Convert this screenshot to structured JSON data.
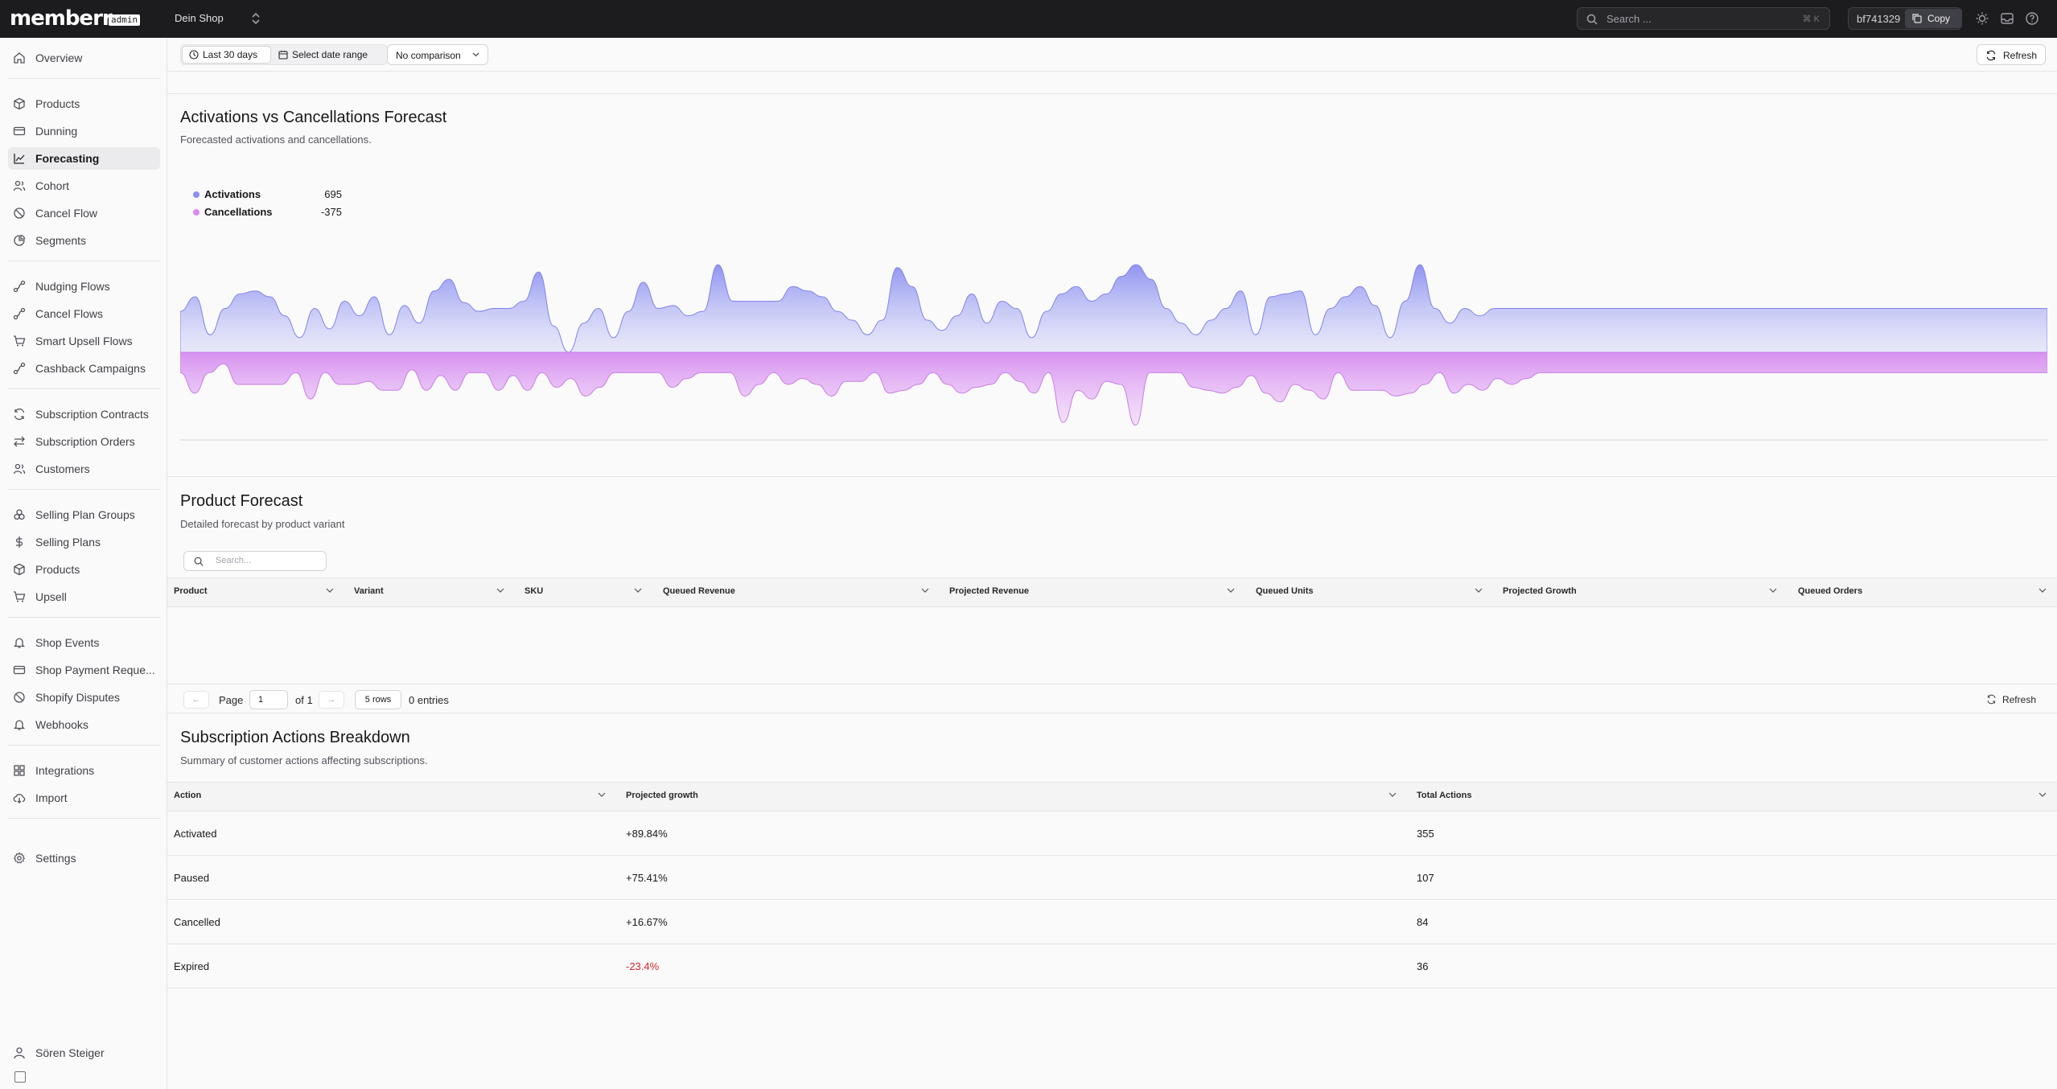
{
  "topbar": {
    "logo": "memberr",
    "logo_badge": "admin",
    "shop_name": "Dein Shop",
    "search_placeholder": "Search ...",
    "search_shortcut": "⌘ K",
    "shop_id": "bf741329",
    "copy_label": "Copy"
  },
  "sidebar": {
    "items": [
      {
        "label": "Overview",
        "icon": "home-icon"
      },
      {
        "label": "Products",
        "icon": "box-icon"
      },
      {
        "label": "Dunning",
        "icon": "card-icon"
      },
      {
        "label": "Forecasting",
        "icon": "line-chart-icon"
      },
      {
        "label": "Cohort",
        "icon": "users-icon"
      },
      {
        "label": "Cancel Flow",
        "icon": "ban-icon"
      },
      {
        "label": "Segments",
        "icon": "pie-icon"
      },
      {
        "label": "Nudging Flows",
        "icon": "flow-icon"
      },
      {
        "label": "Cancel Flows",
        "icon": "flow-icon"
      },
      {
        "label": "Smart Upsell Flows",
        "icon": "cart-icon"
      },
      {
        "label": "Cashback Campaigns",
        "icon": "flow-icon"
      },
      {
        "label": "Subscription Contracts",
        "icon": "refresh-icon"
      },
      {
        "label": "Subscription Orders",
        "icon": "arrows-icon"
      },
      {
        "label": "Customers",
        "icon": "users-icon"
      },
      {
        "label": "Selling Plan Groups",
        "icon": "group-icon"
      },
      {
        "label": "Selling Plans",
        "icon": "dollar-icon"
      },
      {
        "label": "Products",
        "icon": "box-icon"
      },
      {
        "label": "Upsell",
        "icon": "cart-icon"
      },
      {
        "label": "Shop Events",
        "icon": "bell-icon"
      },
      {
        "label": "Shop Payment Reque...",
        "icon": "card-icon"
      },
      {
        "label": "Shopify Disputes",
        "icon": "ban-icon"
      },
      {
        "label": "Webhooks",
        "icon": "bell-icon"
      },
      {
        "label": "Integrations",
        "icon": "grid-icon"
      },
      {
        "label": "Import",
        "icon": "cloud-icon"
      },
      {
        "label": "Settings",
        "icon": "gear-icon"
      }
    ],
    "active": "Forecasting",
    "user_name": "Sören Steiger"
  },
  "toolbar": {
    "last_30_days": "Last 30 days",
    "select_date_range": "Select date range",
    "comparison": "No comparison",
    "refresh": "Refresh"
  },
  "forecast": {
    "title": "Activations vs Cancellations Forecast",
    "subtitle": "Forecasted activations and cancellations.",
    "legend": [
      {
        "name": "Activations",
        "value": "695",
        "color": "#8b8ff0"
      },
      {
        "name": "Cancellations",
        "value": "-375",
        "color": "#d68cf0"
      }
    ]
  },
  "chart_data": {
    "type": "area",
    "series": [
      {
        "name": "Activations",
        "values": [
          28,
          38,
          12,
          30,
          40,
          42,
          38,
          25,
          10,
          30,
          16,
          35,
          25,
          38,
          12,
          32,
          20,
          42,
          50,
          34,
          28,
          30,
          30,
          35,
          55,
          18,
          0,
          20,
          30,
          10,
          28,
          48,
          30,
          32,
          25,
          28,
          60,
          35,
          35,
          35,
          35,
          45,
          42,
          38,
          28,
          22,
          12,
          22,
          58,
          45,
          22,
          15,
          25,
          40,
          20,
          35,
          30,
          10,
          28,
          40,
          45,
          35,
          40,
          52,
          60,
          50,
          30,
          20,
          12,
          22,
          30,
          42,
          12,
          38,
          40,
          42,
          12,
          30,
          38,
          45,
          32,
          10,
          35,
          60,
          30,
          20,
          30,
          25,
          30,
          30,
          30,
          30,
          30,
          30,
          30,
          30,
          30,
          30,
          30,
          30,
          30,
          30,
          30,
          30,
          30,
          30,
          30,
          30,
          30,
          30,
          30,
          30,
          30,
          30,
          30,
          30,
          30,
          30,
          30,
          30,
          30,
          30,
          30,
          30,
          30,
          30
        ]
      },
      {
        "name": "Cancellations",
        "values": [
          -14,
          -28,
          -14,
          -8,
          -22,
          -22,
          -22,
          -22,
          -14,
          -32,
          -14,
          -22,
          -22,
          -20,
          -26,
          -26,
          -12,
          -26,
          -16,
          -26,
          -14,
          -14,
          -26,
          -16,
          -26,
          -14,
          -24,
          -18,
          -30,
          -24,
          -14,
          -14,
          -14,
          -14,
          -24,
          -18,
          -14,
          -14,
          -14,
          -30,
          -22,
          -14,
          -22,
          -18,
          -22,
          -30,
          -20,
          -20,
          -14,
          -28,
          -26,
          -22,
          -14,
          -22,
          -28,
          -24,
          -22,
          -14,
          -20,
          -28,
          -14,
          -48,
          -26,
          -32,
          -20,
          -22,
          -50,
          -14,
          -14,
          -14,
          -24,
          -26,
          -28,
          -24,
          -16,
          -28,
          -34,
          -22,
          -26,
          -32,
          -14,
          -26,
          -26,
          -26,
          -30,
          -28,
          -22,
          -14,
          -28,
          -22,
          -26,
          -18,
          -22,
          -18,
          -14,
          -14,
          -14,
          -14,
          -14,
          -14,
          -14,
          -14,
          -14,
          -14,
          -14,
          -14,
          -14,
          -14,
          -14,
          -14,
          -14,
          -14,
          -14,
          -14,
          -14,
          -14,
          -14,
          -14,
          -14,
          -14,
          -14,
          -14,
          -14,
          -14,
          -14,
          -14,
          -14,
          -14,
          -14,
          -14
        ]
      }
    ],
    "ylim": [
      -60,
      70
    ],
    "legend_position": "top-left",
    "grid": false
  },
  "product_forecast": {
    "title": "Product Forecast",
    "subtitle": "Detailed forecast by product variant",
    "search_placeholder": "Search...",
    "columns": [
      "Product",
      "Variant",
      "SKU",
      "Queued Revenue",
      "Projected Revenue",
      "Queued Units",
      "Projected Growth",
      "Queued Orders"
    ],
    "pager": {
      "page_label": "Page",
      "page_value": "1",
      "of_label": "of 1",
      "rows_label": "5 rows",
      "entries_label": "0 entries",
      "refresh": "Refresh"
    }
  },
  "breakdown": {
    "title": "Subscription Actions Breakdown",
    "subtitle": "Summary of customer actions affecting subscriptions.",
    "columns": [
      "Action",
      "Projected growth",
      "Total Actions"
    ],
    "rows": [
      {
        "action": "Activated",
        "growth": "+89.84%",
        "total": "355"
      },
      {
        "action": "Paused",
        "growth": "+75.41%",
        "total": "107"
      },
      {
        "action": "Cancelled",
        "growth": "+16.67%",
        "total": "84"
      },
      {
        "action": "Expired",
        "growth": "-23.4%",
        "total": "36"
      }
    ]
  }
}
